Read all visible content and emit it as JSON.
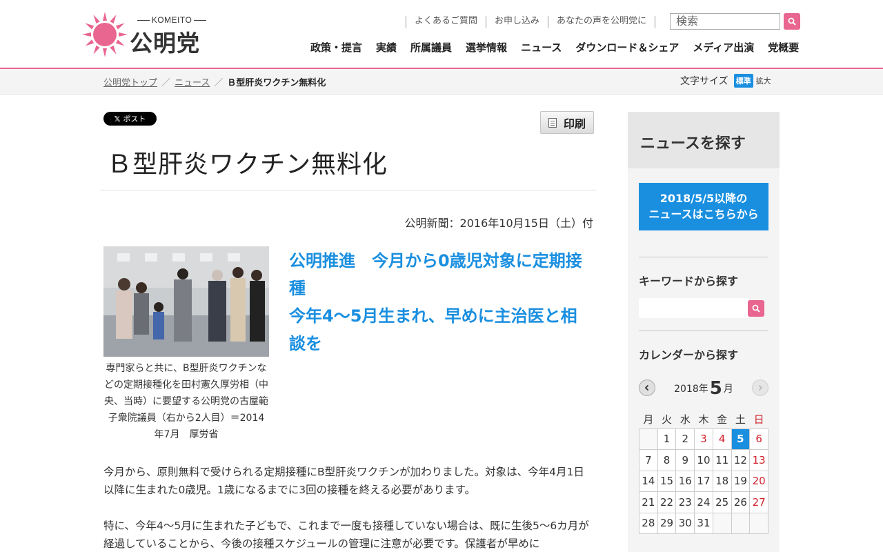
{
  "header": {
    "brand_en": "KOMEITO",
    "brand_jp": "公明党",
    "util_links": [
      "よくあるご質問",
      "お申し込み",
      "あなたの声を公明党に"
    ],
    "search_placeholder": "検索",
    "nav": [
      "政策・提言",
      "実績",
      "所属議員",
      "選挙情報",
      "ニュース",
      "ダウンロード＆シェア",
      "メディア出演",
      "党概要"
    ],
    "accent_color": "#e8668f"
  },
  "breadcrumb": {
    "items": [
      "公明党トップ",
      "ニュース"
    ],
    "current": "Ｂ型肝炎ワクチン無料化",
    "separator": "／"
  },
  "font_size": {
    "label": "文字サイズ",
    "standard": "標準",
    "large": "拡大"
  },
  "article": {
    "share_label": "ポスト",
    "share_logo": "𝕏",
    "print_label": "印刷",
    "title": "Ｂ型肝炎ワクチン無料化",
    "pub_date": "公明新聞：2016年10月15日（土）付",
    "photo_caption": "専門家らと共に、B型肝炎ワクチンなどの定期接種化を田村憲久厚労相（中央、当時）に要望する公明党の古屋範子衆院議員（右から2人目）＝2014年7月　厚労省",
    "subhead_line1": "公明推進　今月から0歳児対象に定期接種",
    "subhead_line2": "今年4～5月生まれ、早めに主治医と相談を",
    "paragraphs": [
      "今月から、原則無料で受けられる定期接種にB型肝炎ワクチンが加わりました。対象は、今年4月1日以降に生まれた0歳児。1歳になるまでに3回の接種を終える必要があります。",
      "特に、今年4～5月に生まれた子どもで、これまで一度も接種していない場合は、既に生後5～6カ月が経過していることから、今後の接種スケジュールの管理に注意が必要です。保護者が早めに"
    ],
    "link_color": "#1a8fe0"
  },
  "sidebar": {
    "heading": "ニュースを探す",
    "archive_line1": "2018/5/5以降の",
    "archive_line2": "ニュースはこちらから",
    "keyword_label": "キーワードから探す",
    "calendar_label": "カレンダーから探す",
    "calendar": {
      "year_text": "2018年",
      "month": "5",
      "month_suffix": "月",
      "weekdays": [
        "月",
        "火",
        "水",
        "木",
        "金",
        "土",
        "日"
      ],
      "weeks": [
        [
          "",
          "1",
          "2",
          "3",
          "4",
          "5",
          "6"
        ],
        [
          "7",
          "8",
          "9",
          "10",
          "11",
          "12",
          "13"
        ],
        [
          "14",
          "15",
          "16",
          "17",
          "18",
          "19",
          "20"
        ],
        [
          "21",
          "22",
          "23",
          "24",
          "25",
          "26",
          "27"
        ],
        [
          "28",
          "29",
          "30",
          "31",
          "",
          "",
          ""
        ]
      ],
      "holidays": [
        "3",
        "4",
        "6",
        "13",
        "20",
        "27"
      ],
      "today": "5"
    }
  }
}
